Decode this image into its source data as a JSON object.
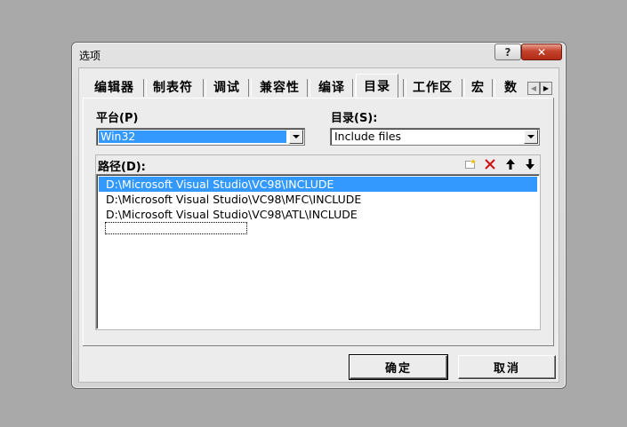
{
  "window": {
    "title": "选项",
    "help_label": "?",
    "close_label": "✕"
  },
  "tabs": [
    {
      "label": "编辑器"
    },
    {
      "label": "制表符"
    },
    {
      "label": "调试"
    },
    {
      "label": "兼容性"
    },
    {
      "label": "编译"
    },
    {
      "label": "目录",
      "active": true
    },
    {
      "label": "工作区"
    },
    {
      "label": "宏"
    },
    {
      "label": "数"
    }
  ],
  "tab_scroll": {
    "left": "◀",
    "right": "▶"
  },
  "platform": {
    "label": "平台(P)",
    "value": "Win32"
  },
  "directory": {
    "label": "目录(S):",
    "value": "Include files"
  },
  "paths": {
    "label": "路径(D):",
    "items": [
      "D:\\Microsoft Visual Studio\\VC98\\INCLUDE",
      "D:\\Microsoft Visual Studio\\VC98\\MFC\\INCLUDE",
      "D:\\Microsoft Visual Studio\\VC98\\ATL\\INCLUDE"
    ],
    "selected_index": 0
  },
  "toolbar_icons": [
    "new-folder-icon",
    "delete-icon",
    "move-up-icon",
    "move-down-icon"
  ],
  "buttons": {
    "ok": "确定",
    "cancel": "取消"
  }
}
